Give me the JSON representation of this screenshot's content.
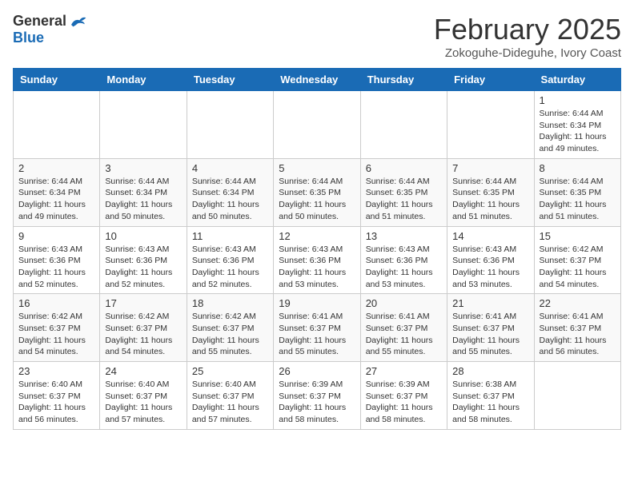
{
  "header": {
    "logo_general": "General",
    "logo_blue": "Blue",
    "month_title": "February 2025",
    "subtitle": "Zokoguhe-Dideguhe, Ivory Coast"
  },
  "weekdays": [
    "Sunday",
    "Monday",
    "Tuesday",
    "Wednesday",
    "Thursday",
    "Friday",
    "Saturday"
  ],
  "weeks": [
    [
      {
        "day": "",
        "info": ""
      },
      {
        "day": "",
        "info": ""
      },
      {
        "day": "",
        "info": ""
      },
      {
        "day": "",
        "info": ""
      },
      {
        "day": "",
        "info": ""
      },
      {
        "day": "",
        "info": ""
      },
      {
        "day": "1",
        "info": "Sunrise: 6:44 AM\nSunset: 6:34 PM\nDaylight: 11 hours\nand 49 minutes."
      }
    ],
    [
      {
        "day": "2",
        "info": "Sunrise: 6:44 AM\nSunset: 6:34 PM\nDaylight: 11 hours\nand 49 minutes."
      },
      {
        "day": "3",
        "info": "Sunrise: 6:44 AM\nSunset: 6:34 PM\nDaylight: 11 hours\nand 50 minutes."
      },
      {
        "day": "4",
        "info": "Sunrise: 6:44 AM\nSunset: 6:34 PM\nDaylight: 11 hours\nand 50 minutes."
      },
      {
        "day": "5",
        "info": "Sunrise: 6:44 AM\nSunset: 6:35 PM\nDaylight: 11 hours\nand 50 minutes."
      },
      {
        "day": "6",
        "info": "Sunrise: 6:44 AM\nSunset: 6:35 PM\nDaylight: 11 hours\nand 51 minutes."
      },
      {
        "day": "7",
        "info": "Sunrise: 6:44 AM\nSunset: 6:35 PM\nDaylight: 11 hours\nand 51 minutes."
      },
      {
        "day": "8",
        "info": "Sunrise: 6:44 AM\nSunset: 6:35 PM\nDaylight: 11 hours\nand 51 minutes."
      }
    ],
    [
      {
        "day": "9",
        "info": "Sunrise: 6:43 AM\nSunset: 6:36 PM\nDaylight: 11 hours\nand 52 minutes."
      },
      {
        "day": "10",
        "info": "Sunrise: 6:43 AM\nSunset: 6:36 PM\nDaylight: 11 hours\nand 52 minutes."
      },
      {
        "day": "11",
        "info": "Sunrise: 6:43 AM\nSunset: 6:36 PM\nDaylight: 11 hours\nand 52 minutes."
      },
      {
        "day": "12",
        "info": "Sunrise: 6:43 AM\nSunset: 6:36 PM\nDaylight: 11 hours\nand 53 minutes."
      },
      {
        "day": "13",
        "info": "Sunrise: 6:43 AM\nSunset: 6:36 PM\nDaylight: 11 hours\nand 53 minutes."
      },
      {
        "day": "14",
        "info": "Sunrise: 6:43 AM\nSunset: 6:36 PM\nDaylight: 11 hours\nand 53 minutes."
      },
      {
        "day": "15",
        "info": "Sunrise: 6:42 AM\nSunset: 6:37 PM\nDaylight: 11 hours\nand 54 minutes."
      }
    ],
    [
      {
        "day": "16",
        "info": "Sunrise: 6:42 AM\nSunset: 6:37 PM\nDaylight: 11 hours\nand 54 minutes."
      },
      {
        "day": "17",
        "info": "Sunrise: 6:42 AM\nSunset: 6:37 PM\nDaylight: 11 hours\nand 54 minutes."
      },
      {
        "day": "18",
        "info": "Sunrise: 6:42 AM\nSunset: 6:37 PM\nDaylight: 11 hours\nand 55 minutes."
      },
      {
        "day": "19",
        "info": "Sunrise: 6:41 AM\nSunset: 6:37 PM\nDaylight: 11 hours\nand 55 minutes."
      },
      {
        "day": "20",
        "info": "Sunrise: 6:41 AM\nSunset: 6:37 PM\nDaylight: 11 hours\nand 55 minutes."
      },
      {
        "day": "21",
        "info": "Sunrise: 6:41 AM\nSunset: 6:37 PM\nDaylight: 11 hours\nand 55 minutes."
      },
      {
        "day": "22",
        "info": "Sunrise: 6:41 AM\nSunset: 6:37 PM\nDaylight: 11 hours\nand 56 minutes."
      }
    ],
    [
      {
        "day": "23",
        "info": "Sunrise: 6:40 AM\nSunset: 6:37 PM\nDaylight: 11 hours\nand 56 minutes."
      },
      {
        "day": "24",
        "info": "Sunrise: 6:40 AM\nSunset: 6:37 PM\nDaylight: 11 hours\nand 57 minutes."
      },
      {
        "day": "25",
        "info": "Sunrise: 6:40 AM\nSunset: 6:37 PM\nDaylight: 11 hours\nand 57 minutes."
      },
      {
        "day": "26",
        "info": "Sunrise: 6:39 AM\nSunset: 6:37 PM\nDaylight: 11 hours\nand 58 minutes."
      },
      {
        "day": "27",
        "info": "Sunrise: 6:39 AM\nSunset: 6:37 PM\nDaylight: 11 hours\nand 58 minutes."
      },
      {
        "day": "28",
        "info": "Sunrise: 6:38 AM\nSunset: 6:37 PM\nDaylight: 11 hours\nand 58 minutes."
      },
      {
        "day": "",
        "info": ""
      }
    ]
  ]
}
